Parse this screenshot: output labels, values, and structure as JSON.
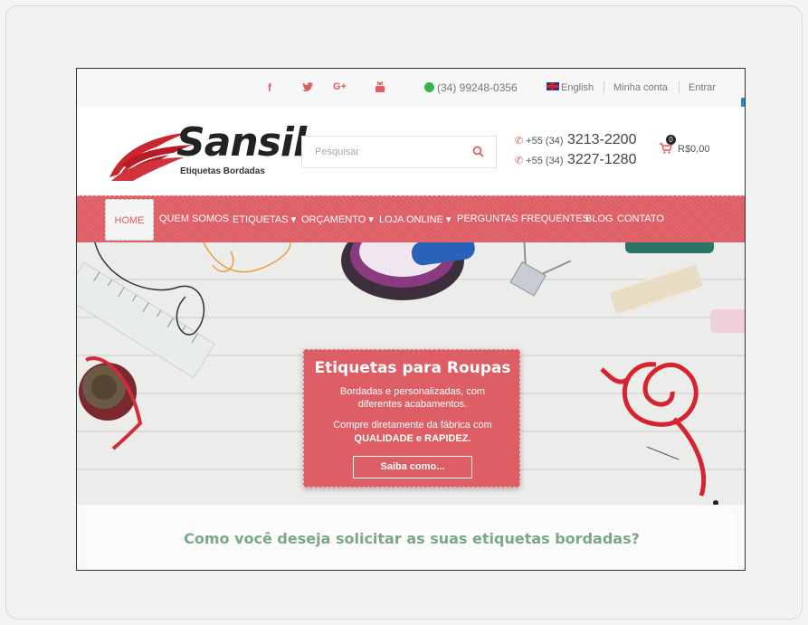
{
  "topbar": {
    "social": [
      "f",
      "t",
      "G+",
      "yt"
    ],
    "whatsapp_phone": "(34) 99248-0356",
    "language": "English",
    "account_link": "Minha conta",
    "login_link": "Entrar"
  },
  "header": {
    "logo_text": "Sansil",
    "logo_subtitle": "Etiquetas Bordadas",
    "search_placeholder": "Pesquisar",
    "phones": [
      {
        "prefix": "+55 (34)",
        "number": "3213-2200"
      },
      {
        "prefix": "+55 (34)",
        "number": "3227-1280"
      }
    ],
    "cart_count": "0",
    "cart_total": "R$0,00"
  },
  "nav": {
    "items": [
      {
        "label": "HOME"
      },
      {
        "label": "QUEM SOMOS"
      },
      {
        "label": "ETIQUETAS ▾"
      },
      {
        "label": "ORÇAMENTO ▾"
      },
      {
        "label": "LOJA ONLINE ▾"
      },
      {
        "label": "PERGUNTAS FREQUENTES"
      },
      {
        "label": "BLOG"
      },
      {
        "label": "CONTATO"
      }
    ]
  },
  "hero": {
    "title": "Etiquetas para Roupas",
    "description": "Bordadas e personalizadas, com diferentes acabamentos.",
    "buy_text": "Compre diretamente da fábrica com",
    "buy_emphasis": "QUALIDADE e RAPIDEZ.",
    "button_label": "Saiba como..."
  },
  "section": {
    "question": "Como você deseja solicitar as suas etiquetas bordadas?"
  },
  "colors": {
    "brand": "#dd5e64",
    "accent_green": "#7aa787"
  }
}
